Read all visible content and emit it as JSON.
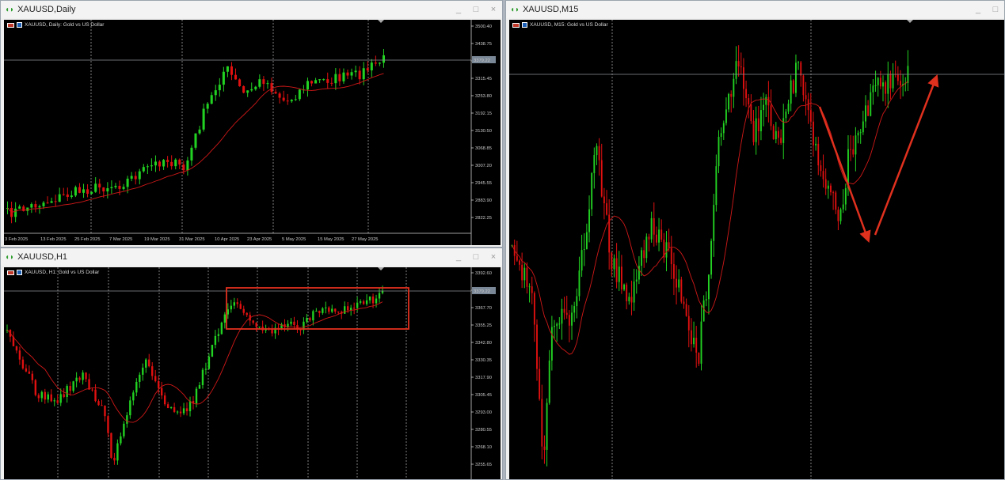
{
  "windows": {
    "daily": {
      "title": "XAUUSD,Daily",
      "chart_label": "XAUUSD, Daily:  Gold vs US Dollar",
      "price_ticks": [
        "3500.40",
        "3438.75",
        "3377.10",
        "3315.45",
        "3253.80",
        "3192.15",
        "3130.50",
        "3068.85",
        "3007.20",
        "2945.55",
        "2883.90",
        "2822.25"
      ],
      "current_price": "3379.22",
      "date_ticks": [
        "3 Feb 2025",
        "13 Feb 2025",
        "25 Feb 2025",
        "7 Mar 2025",
        "19 Mar 2025",
        "31 Mar 2025",
        "10 Apr 2025",
        "23 Apr 2025",
        "5 May 2025",
        "15 May 2025",
        "27 May 2025"
      ]
    },
    "h1": {
      "title": "XAUUSD,H1",
      "chart_label": "XAUUSD, H1:  Gold vs US Dollar",
      "price_ticks": [
        "3392.60",
        "3379.22",
        "3367.70",
        "3355.25",
        "3342.80",
        "3330.35",
        "3317.90",
        "3305.45",
        "3293.00",
        "3280.55",
        "3268.10",
        "3255.65"
      ],
      "current_price": "3379.22"
    },
    "m15": {
      "title": "XAUUSD,M15",
      "chart_label": "XAUUSD, M15:  Gold vs US Dollar"
    }
  },
  "window_buttons": {
    "minimize": "_",
    "maximize": "□",
    "close": "×"
  },
  "colors": {
    "bull": "#22d222",
    "bear": "#e01010",
    "ma": "#d01818",
    "grid": "#d8d8d8",
    "annotation": "#e0301e"
  }
}
